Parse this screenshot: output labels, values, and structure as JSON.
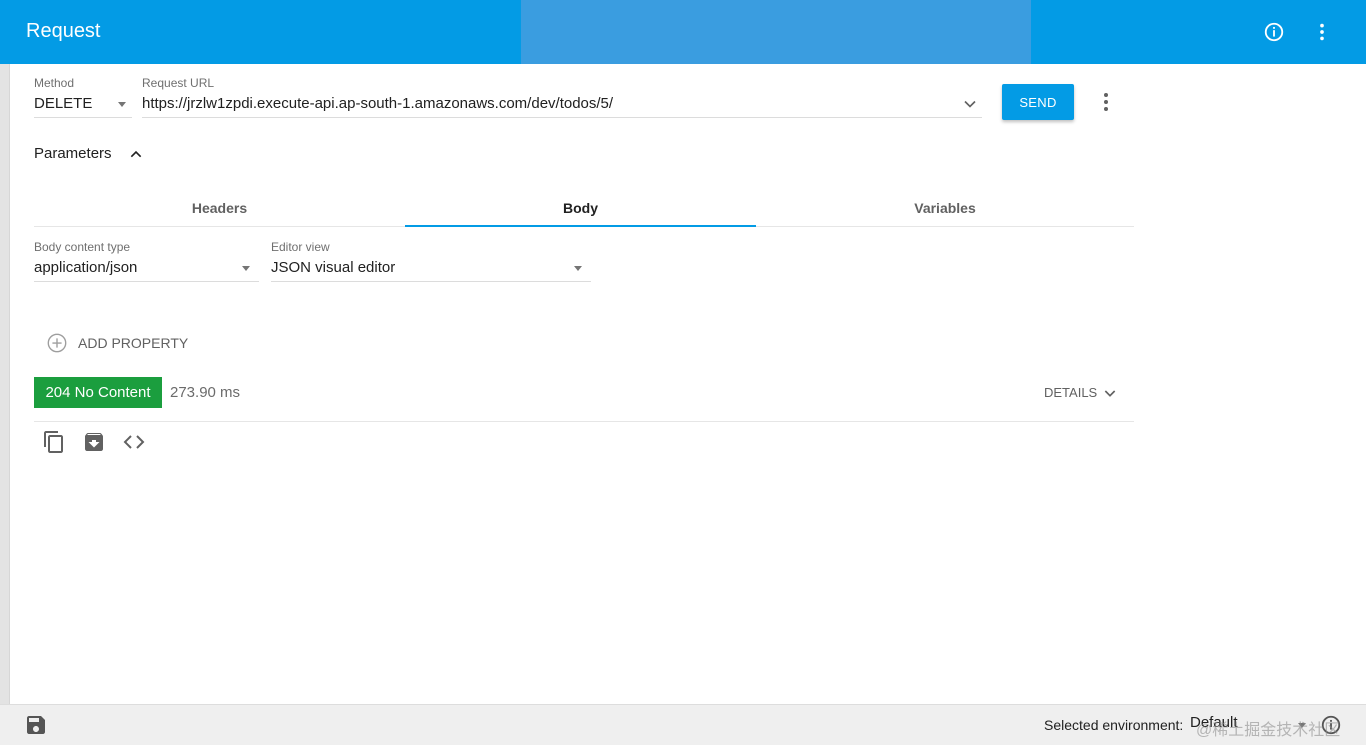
{
  "app": {
    "title": "Request"
  },
  "request": {
    "method_label": "Method",
    "method_value": "DELETE",
    "url_label": "Request URL",
    "url_value": "https://jrzlw1zpdi.execute-api.ap-south-1.amazonaws.com/dev/todos/5/",
    "send_label": "SEND"
  },
  "parameters": {
    "label": "Parameters"
  },
  "tabs": [
    {
      "label": "Headers"
    },
    {
      "label": "Body"
    },
    {
      "label": "Variables"
    }
  ],
  "body": {
    "content_type_label": "Body content type",
    "content_type_value": "application/json",
    "editor_view_label": "Editor view",
    "editor_view_value": "JSON visual editor",
    "add_property_label": "ADD PROPERTY"
  },
  "response": {
    "status": "204 No Content",
    "time": "273.90 ms",
    "details_label": "DETAILS",
    "status_color": "#1b9e3e"
  },
  "footer": {
    "env_label": "Selected environment:",
    "env_value": "Default",
    "watermark": "@稀土掘金技术社区"
  },
  "colors": {
    "accent": "#039be5"
  }
}
